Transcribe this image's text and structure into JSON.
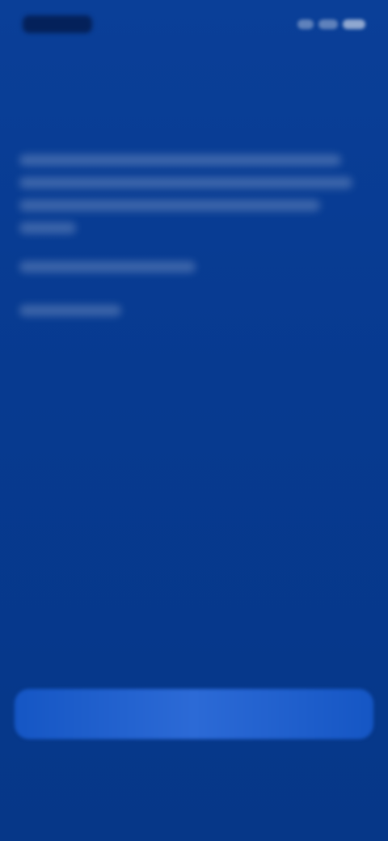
{
  "screen": {
    "background_color": "#073a93",
    "button_color": "#2c6ad6"
  },
  "status_bar": {
    "icons": [
      "signal-icon",
      "wifi-icon",
      "battery-icon"
    ]
  },
  "header": {
    "title": ""
  },
  "content": {
    "headline": "",
    "paragraph_lines": [
      "",
      "",
      "",
      ""
    ],
    "info_line_1": "",
    "info_line_2": ""
  },
  "actions": {
    "primary_label": "",
    "secondary_label": ""
  }
}
